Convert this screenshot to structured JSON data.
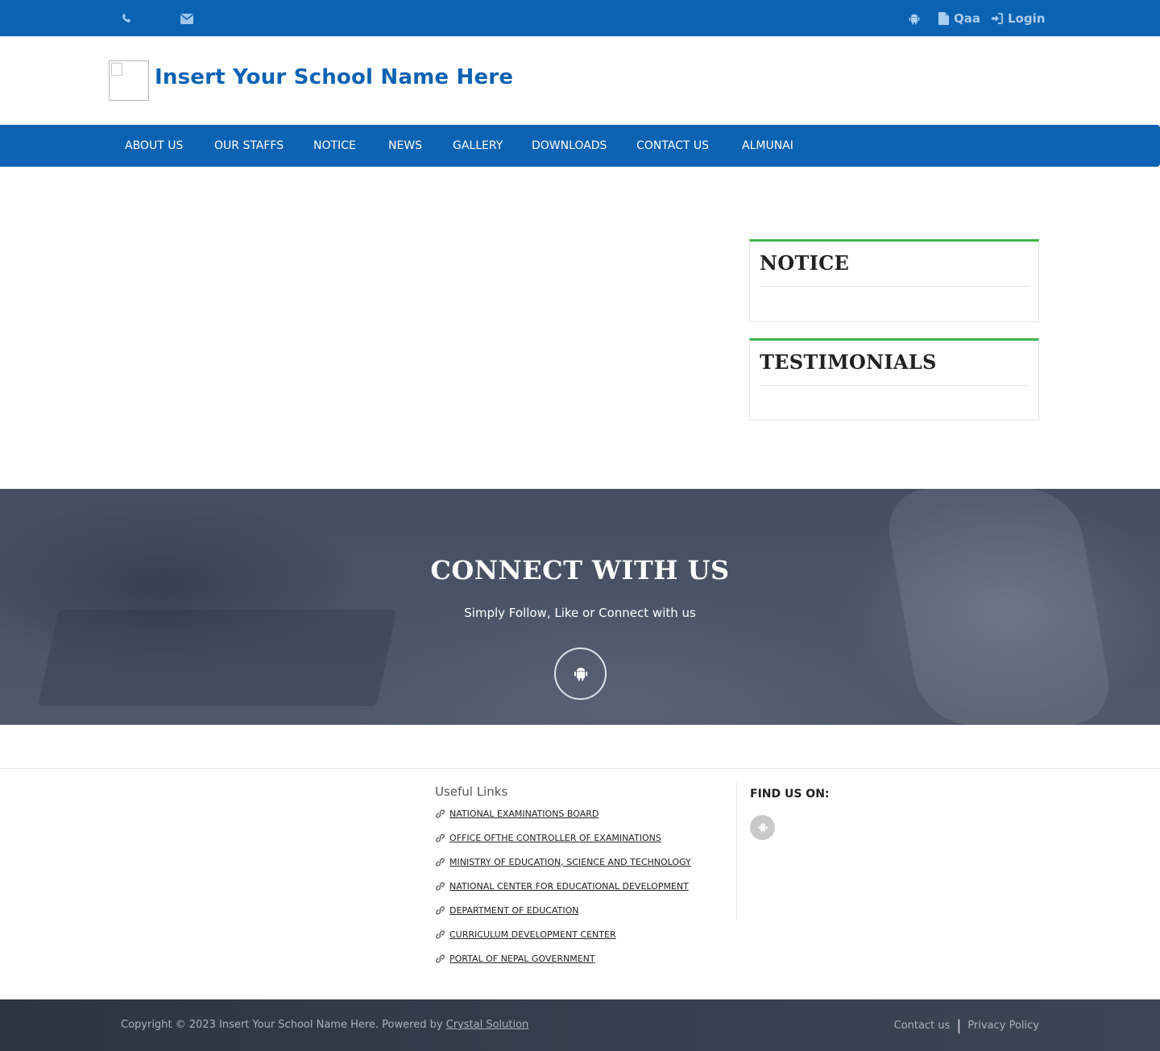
{
  "colors": {
    "primary": "#0a62b2",
    "accent_green": "#3cb44a",
    "footer_dark": "#343f4d"
  },
  "topbar": {
    "phone_icon": "phone-icon",
    "email_icon": "envelope-icon",
    "android_icon": "android-icon",
    "qaa_label": "Qaa",
    "login_label": "Login"
  },
  "header": {
    "school_name": "Insert Your School Name Here"
  },
  "nav": {
    "items": [
      "About Us",
      "Our Staffs",
      "Notice",
      "News",
      "Gallery",
      "Downloads",
      "Contact Us",
      "Almunai"
    ]
  },
  "sidebar": {
    "notice_title": "NOTICE",
    "testimonials_title": "TESTIMONIALS"
  },
  "connect": {
    "title": "CONNECT WITH US",
    "subtitle": "Simply Follow, Like or Connect with us"
  },
  "footer": {
    "useful_links_title": "Useful Links",
    "links": [
      "National Examinations Board",
      "Office ofthe Controller of Examinations",
      "Ministry of Education, Science and Technology",
      "National Center for Educational Development",
      "Department of Education",
      "Curriculum Development Center",
      "Portal of Nepal Government"
    ],
    "find_us_title": "FIND US ON:",
    "copyright_text": "Copyright © 2023 Insert Your School Name Here. Powered by ",
    "powered_by_link": "Crystal Solution",
    "contact_link": "Contact us",
    "separator": "|",
    "privacy_link": "Privacy Policy"
  }
}
